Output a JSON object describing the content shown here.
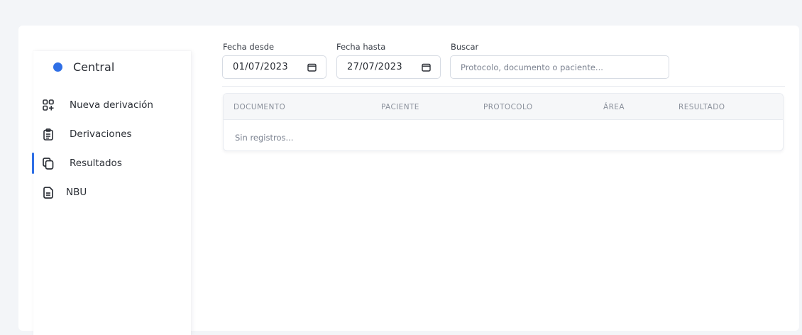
{
  "sidebar": {
    "brand": "Central",
    "items": [
      {
        "label": "Nueva derivación",
        "icon": "grid-plus-icon",
        "active": false
      },
      {
        "label": "Derivaciones",
        "icon": "clipboard-list-icon",
        "active": false
      },
      {
        "label": "Resultados",
        "icon": "copy-icon",
        "active": true
      },
      {
        "label": "NBU",
        "icon": "document-icon",
        "active": false
      }
    ]
  },
  "filters": {
    "date_from_label": "Fecha desde",
    "date_from_value": "01/07/2023",
    "date_to_label": "Fecha hasta",
    "date_to_value": "27/07/2023",
    "search_label": "Buscar",
    "search_placeholder": "Protocolo, documento o paciente..."
  },
  "table": {
    "columns": [
      "DOCUMENTO",
      "PACIENTE",
      "PROTOCOLO",
      "ÁREA",
      "RESULTADO"
    ],
    "empty_text": "Sin registros..."
  },
  "colors": {
    "accent": "#2f6fe6",
    "background": "#f3f5f8"
  }
}
